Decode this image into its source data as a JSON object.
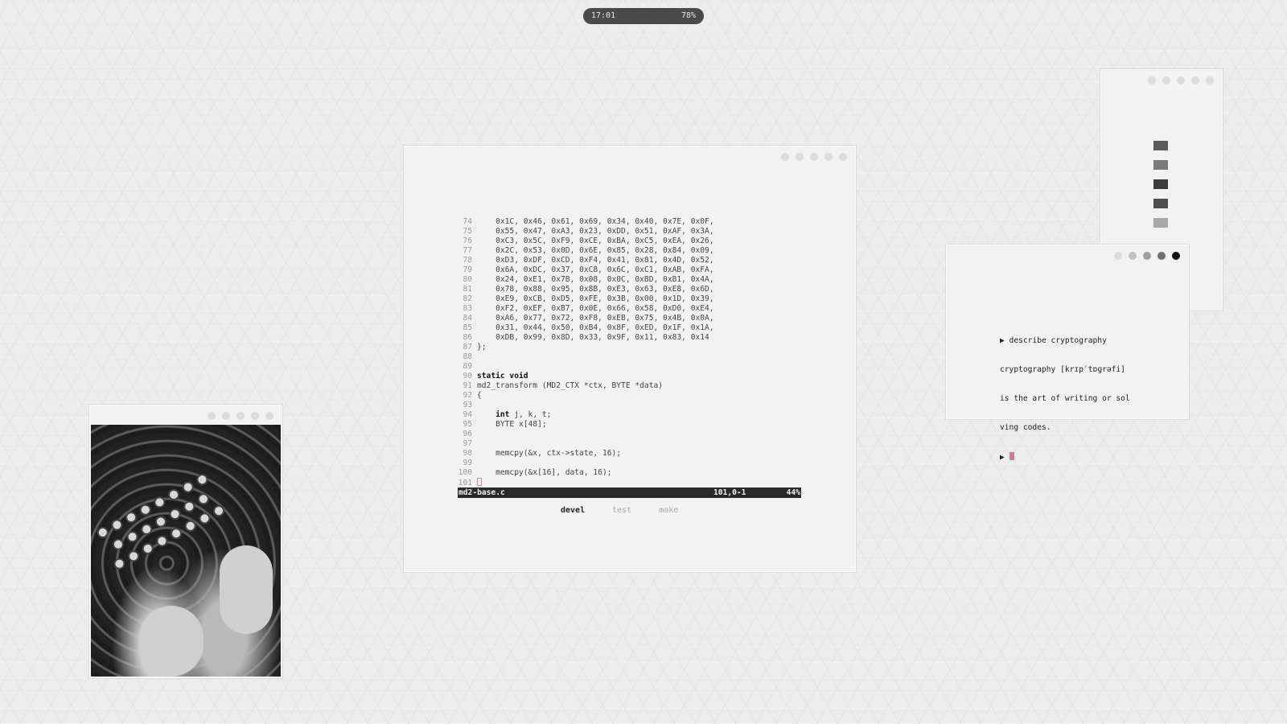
{
  "status_bar": {
    "time": "17:01",
    "battery": "78%"
  },
  "editor": {
    "lines": [
      {
        "n": "74",
        "text": "    0x1C, 0x46, 0x61, 0x69, 0x34, 0x40, 0x7E, 0x0F,"
      },
      {
        "n": "75",
        "text": "    0x55, 0x47, 0xA3, 0x23, 0xDD, 0x51, 0xAF, 0x3A,"
      },
      {
        "n": "76",
        "text": "    0xC3, 0x5C, 0xF9, 0xCE, 0xBA, 0xC5, 0xEA, 0x26,"
      },
      {
        "n": "77",
        "text": "    0x2C, 0x53, 0x0D, 0x6E, 0x85, 0x28, 0x84, 0x09,"
      },
      {
        "n": "78",
        "text": "    0xD3, 0xDF, 0xCD, 0xF4, 0x41, 0x81, 0x4D, 0x52,"
      },
      {
        "n": "79",
        "text": "    0x6A, 0xDC, 0x37, 0xC8, 0x6C, 0xC1, 0xAB, 0xFA,"
      },
      {
        "n": "80",
        "text": "    0x24, 0xE1, 0x7B, 0x08, 0x0C, 0xBD, 0xB1, 0x4A,"
      },
      {
        "n": "81",
        "text": "    0x78, 0x88, 0x95, 0x8B, 0xE3, 0x63, 0xE8, 0x6D,"
      },
      {
        "n": "82",
        "text": "    0xE9, 0xCB, 0xD5, 0xFE, 0x3B, 0x00, 0x1D, 0x39,"
      },
      {
        "n": "83",
        "text": "    0xF2, 0xEF, 0xB7, 0x0E, 0x66, 0x58, 0xD0, 0xE4,"
      },
      {
        "n": "84",
        "text": "    0xA6, 0x77, 0x72, 0xF8, 0xEB, 0x75, 0x4B, 0x0A,"
      },
      {
        "n": "85",
        "text": "    0x31, 0x44, 0x50, 0xB4, 0x8F, 0xED, 0x1F, 0x1A,"
      },
      {
        "n": "86",
        "text": "    0xDB, 0x99, 0x8D, 0x33, 0x9F, 0x11, 0x83, 0x14"
      },
      {
        "n": "87",
        "text": "};"
      },
      {
        "n": "88",
        "text": ""
      },
      {
        "n": "89",
        "text": ""
      },
      {
        "n": "90",
        "text": "static void",
        "bold": true
      },
      {
        "n": "91",
        "text": "md2_transform (MD2_CTX *ctx, BYTE *data)"
      },
      {
        "n": "92",
        "text": "{"
      },
      {
        "n": "93",
        "text": ""
      },
      {
        "n": "94",
        "text": "    int j, k, t;",
        "kw": "int"
      },
      {
        "n": "95",
        "text": "    BYTE x[48];"
      },
      {
        "n": "96",
        "text": ""
      },
      {
        "n": "97",
        "text": ""
      },
      {
        "n": "98",
        "text": "    memcpy(&x, ctx->state, 16);"
      },
      {
        "n": "99",
        "text": ""
      },
      {
        "n": "100",
        "text": "    memcpy(&x[16], data, 16);"
      },
      {
        "n": "101",
        "text": "",
        "cursor": true
      }
    ],
    "statusline": {
      "filename": "md2-base.c",
      "position": "101,0-1",
      "percent": "44%"
    },
    "tabs": [
      {
        "label": "devel",
        "active": true
      },
      {
        "label": "test",
        "active": false
      },
      {
        "label": "make",
        "active": false
      }
    ]
  },
  "swatches": {
    "colors": [
      "#5b5b5b",
      "#7b7b7b",
      "#3c3c3c",
      "#4e4e4e",
      "#a8a8a8"
    ]
  },
  "terminal": {
    "lines": [
      "▶ describe cryptography",
      "cryptography [krɪpˈtɒɡrəfi]",
      "is the art of writing or sol",
      "ving codes."
    ],
    "prompt": "▶ "
  },
  "photo": {
    "alt_icon": "enigma-machine-photo"
  }
}
